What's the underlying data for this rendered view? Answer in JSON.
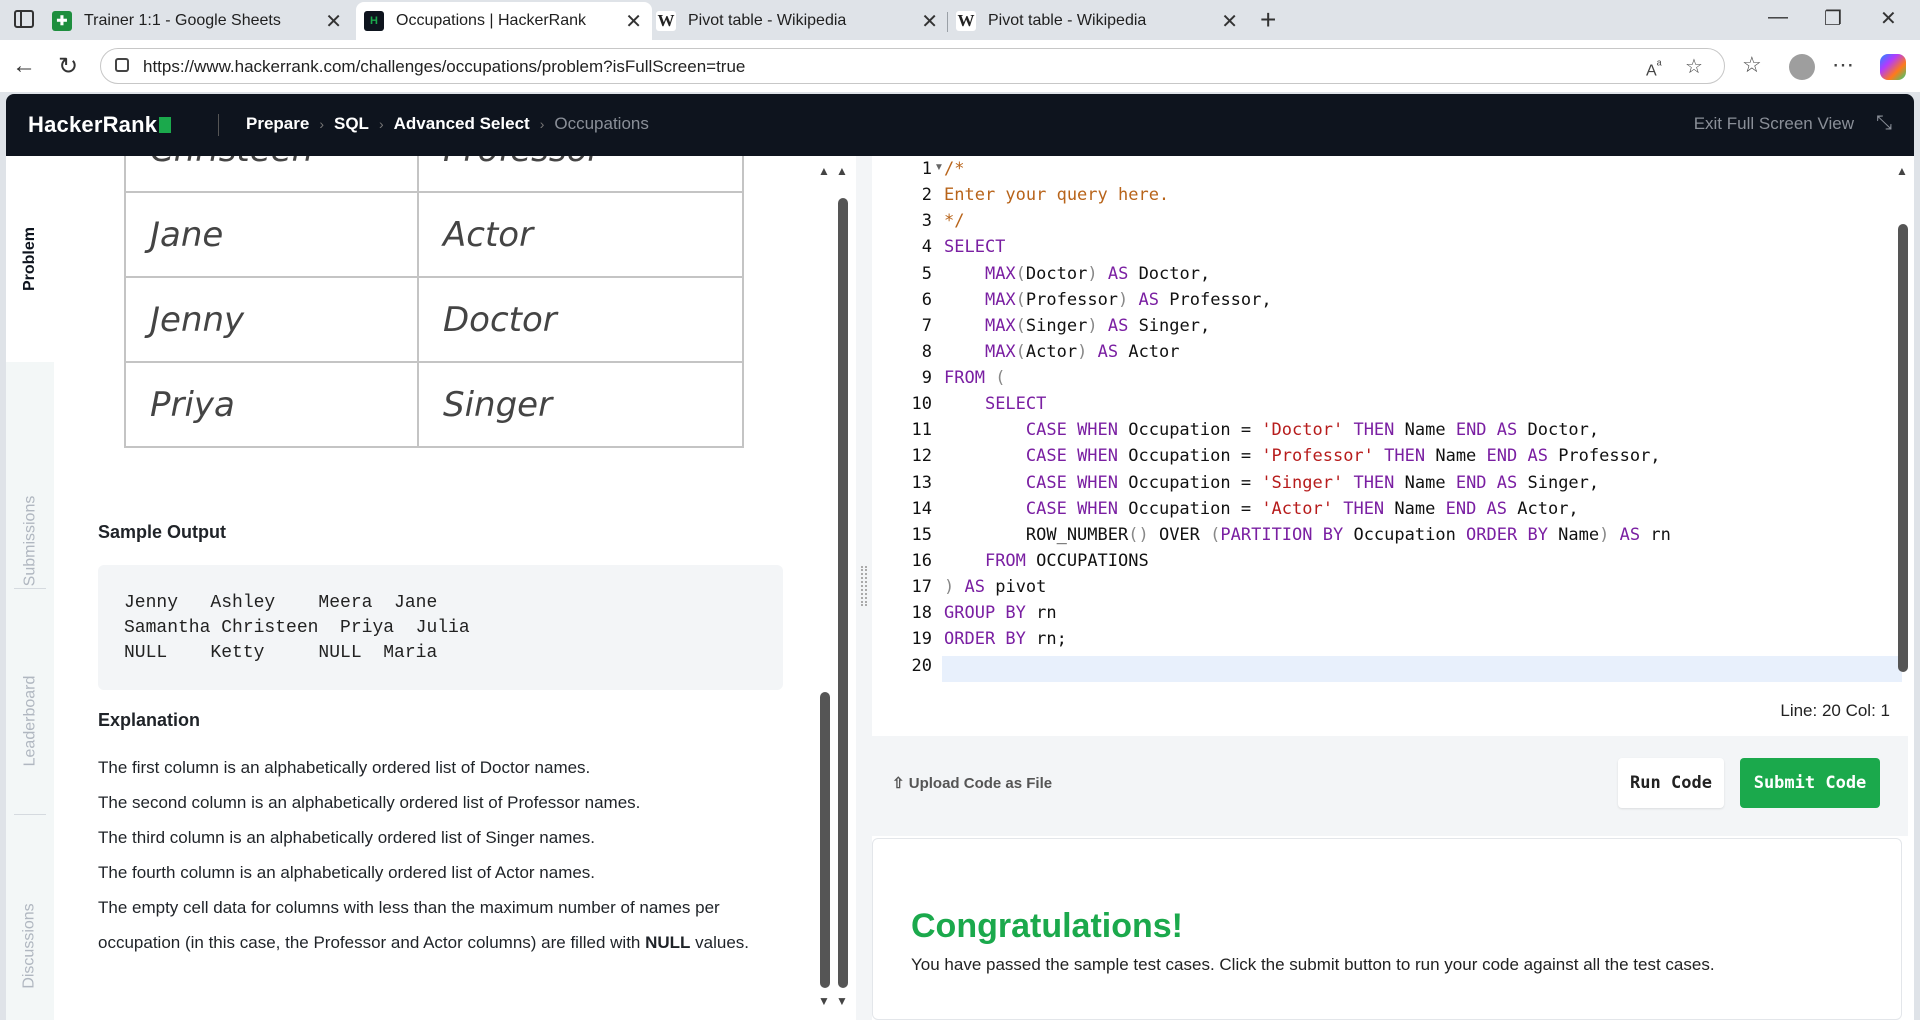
{
  "browser": {
    "tabs": [
      {
        "title": "Trainer 1:1 - Google Sheets",
        "icon": "sheets-icon",
        "active": false
      },
      {
        "title": "Occupations | HackerRank",
        "icon": "hackerrank-icon",
        "active": true
      },
      {
        "title": "Pivot table - Wikipedia",
        "icon": "wikipedia-icon",
        "active": false
      },
      {
        "title": "Pivot table - Wikipedia",
        "icon": "wikipedia-icon",
        "active": false
      }
    ],
    "url": "https://www.hackerrank.com/challenges/occupations/problem?isFullScreen=true"
  },
  "header": {
    "logo": "HackerRank",
    "breadcrumbs": [
      "Prepare",
      "SQL",
      "Advanced Select",
      "Occupations"
    ],
    "exit_label": "Exit Full Screen View"
  },
  "sidenav": [
    "Problem",
    "Submissions",
    "Leaderboard",
    "Discussions"
  ],
  "problem": {
    "table_rows": [
      [
        "Christeen",
        "Professor"
      ],
      [
        "Jane",
        "Actor"
      ],
      [
        "Jenny",
        "Doctor"
      ],
      [
        "Priya",
        "Singer"
      ]
    ],
    "sample_output_heading": "Sample Output",
    "sample_output": "Jenny   Ashley    Meera  Jane\nSamantha Christeen  Priya  Julia\nNULL    Ketty     NULL  Maria",
    "explanation_heading": "Explanation",
    "explanation": [
      "The first column is an alphabetically ordered list of Doctor names.",
      "The second column is an alphabetically ordered list of Professor names.",
      "The third column is an alphabetically ordered list of Singer names.",
      "The fourth column is an alphabetically ordered list of Actor names.",
      "The empty cell data for columns with less than the maximum number of names per"
    ],
    "explanation_last_pre": "occupation (in this case, the Professor and Actor columns) are filled with ",
    "explanation_last_bold": "NULL",
    "explanation_last_post": " values."
  },
  "editor": {
    "line_numbers": [
      "1",
      "2",
      "3",
      "4",
      "5",
      "6",
      "7",
      "8",
      "9",
      "10",
      "11",
      "12",
      "13",
      "14",
      "15",
      "16",
      "17",
      "18",
      "19",
      "20"
    ],
    "status": "Line: 20 Col: 1"
  },
  "actions": {
    "upload_label": "Upload Code as File",
    "run_label": "Run Code",
    "submit_label": "Submit Code"
  },
  "result": {
    "title": "Congratulations!",
    "message": "You have passed the sample test cases. Click the submit button to run your code against all the test cases."
  },
  "colors": {
    "brand_green": "#1ba94c",
    "header_bg": "#0e141e"
  }
}
